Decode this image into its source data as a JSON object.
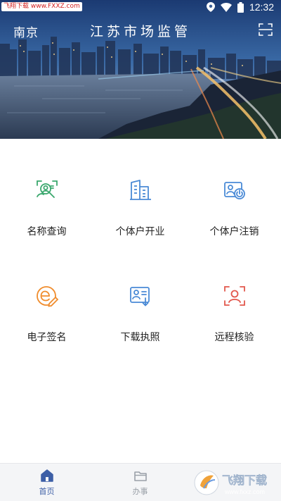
{
  "status_bar": {
    "watermark": "飞翔下载 www.FXXZ.com",
    "time": "12:32",
    "icons": [
      "location-icon",
      "wifi-icon",
      "battery-icon"
    ]
  },
  "header": {
    "city": "南京",
    "title": "江苏市场监管",
    "scan_icon": "scan-icon"
  },
  "services": [
    {
      "label": "名称查询",
      "icon": "name-search-icon",
      "color": "#3aa76d"
    },
    {
      "label": "个体户开业",
      "icon": "building-icon",
      "color": "#4a8ad6"
    },
    {
      "label": "个体户注销",
      "icon": "cancel-id-icon",
      "color": "#4a8ad6"
    },
    {
      "label": "电子签名",
      "icon": "e-sign-icon",
      "color": "#f08c2c"
    },
    {
      "label": "下载执照",
      "icon": "download-license-icon",
      "color": "#4a8ad6"
    },
    {
      "label": "远程核验",
      "icon": "face-verify-icon",
      "color": "#e2574c"
    }
  ],
  "bottom_nav": {
    "items": [
      {
        "label": "首页",
        "icon": "home-icon",
        "active": true
      },
      {
        "label": "办事",
        "icon": "folder-icon",
        "active": false
      }
    ],
    "watermark": "飞翔下载 www.fxxz.com"
  },
  "colors": {
    "accent": "#3d5fa6",
    "nav_bg": "#f4f5f7"
  }
}
